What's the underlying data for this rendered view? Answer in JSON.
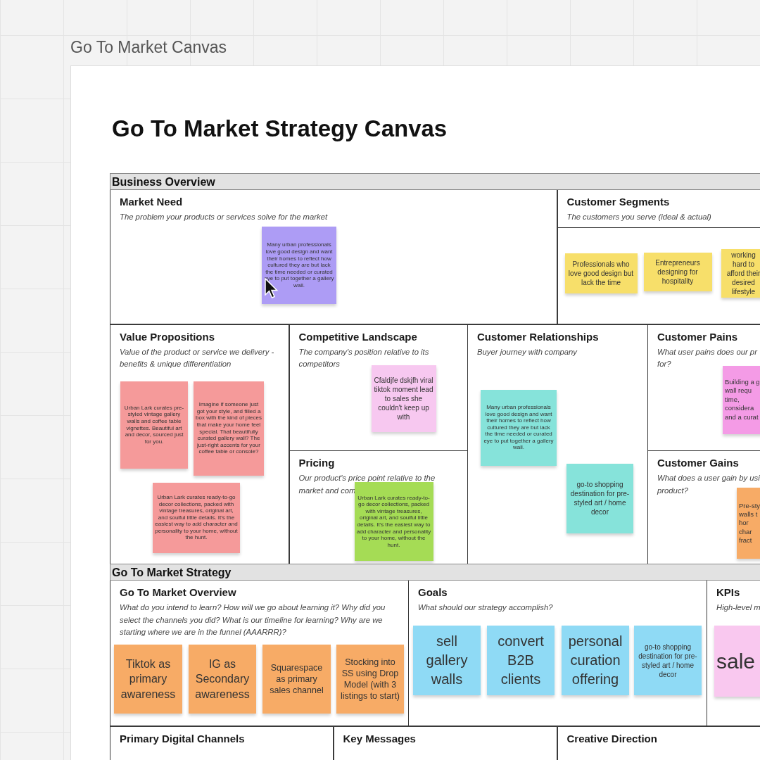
{
  "canvas": {
    "title": "Go To Market Canvas"
  },
  "board": {
    "title": "Go To Market Strategy Canvas",
    "groups": [
      {
        "heading": "Business Overview",
        "sections": [
          {
            "title": "Market Need",
            "subtitle": "The problem your products or services solve for the market",
            "notes": [
              {
                "text": "Many urban professionals love good design and want their homes to reflect how cultured they are but lack the time needed or curated eye to put together a gallery wall.",
                "color": "#ad9cf5",
                "kind": "tiny"
              }
            ]
          },
          {
            "title": "Customer Segments",
            "subtitle": "The customers you serve (ideal & actual)",
            "notes": [
              {
                "text": "Professionals who love good design but lack the time",
                "color": "#f7df6a",
                "kind": "small"
              },
              {
                "text": "Entrepreneurs designing for hospitality",
                "color": "#f7df6a",
                "kind": "small"
              },
              {
                "text": "working hard to afford their desired lifestyle",
                "color": "#f7df6a",
                "kind": "small"
              }
            ]
          },
          {
            "title": "Value Propositions",
            "subtitle": "Value of the product or service we delivery - benefits & unique differentiation",
            "notes": [
              {
                "text": "Urban Lark curates pre-styled vintage gallery walls and coffee table vignettes. Beautiful art and decor, sourced just for you.",
                "color": "#f59a9a",
                "kind": "tiny"
              },
              {
                "text": "Imagine if someone just got your style, and filled a box with the kind of pieces that make your home feel special. That beautifully curated gallery wall? The just-right accents for your coffee table or console?",
                "color": "#f59a9a",
                "kind": "tiny"
              },
              {
                "text": "Urban Lark curates ready-to-go decor collections, packed with vintage treasures, original art, and soulful little details. It's the easiest way to add character and personality to your home, without the hunt.",
                "color": "#f59a9a",
                "kind": "tiny"
              }
            ]
          },
          {
            "title": "Competitive Landscape",
            "subtitle": "The company's position relative to its competitors",
            "notes": [
              {
                "text": "Cfaldjfe dskjfh viral tiktok moment lead to sales she couldn't keep up with",
                "color": "#f7c8f0",
                "kind": "small"
              }
            ]
          },
          {
            "title": "Pricing",
            "subtitle": "Our product's price point relative to the market and com",
            "notes": [
              {
                "text": "Urban Lark curates ready-to-go decor collections, packed with vintage treasures, original art, and soulful little details. It's the easiest way to add character and personality to your home, without the hunt.",
                "color": "#a5dc55",
                "kind": "tiny"
              }
            ]
          },
          {
            "title": "Customer Relationships",
            "subtitle": "Buyer journey with company",
            "notes": [
              {
                "text": "Many urban professionals love good design and want their homes to reflect how cultured they are but lack the time needed or curated eye to put together a gallery wall.",
                "color": "#86e3da",
                "kind": "tiny"
              },
              {
                "text": "go-to shopping destination for pre-styled art / home decor",
                "color": "#86e3da",
                "kind": "small"
              }
            ]
          },
          {
            "title": "Customer Pains",
            "subtitle": "What user pains does our pr\nfor?",
            "notes": [
              {
                "text": "Building a g\nwall requ\ntime,\nconsidera\nand a curat",
                "color": "#f49be6",
                "kind": "small"
              }
            ]
          },
          {
            "title": "Customer Gains",
            "subtitle": "What does a user gain by usi\nproduct?",
            "notes": [
              {
                "text": "Pre-sty\nwalls t\nhor\nchar\nfract",
                "color": "#f7ab66",
                "kind": "small"
              }
            ]
          }
        ]
      },
      {
        "heading": "Go To Market Strategy",
        "sections": [
          {
            "title": "Go To Market Overview",
            "subtitle": "What do you intend to learn? How will we go about learning it? Why did you select the channels you did? What is our timeline for learning? Why are we starting where we are in the funnel (AAARRR)?",
            "notes": [
              {
                "text": "Tiktok as primary awareness",
                "color": "#f7ab66",
                "kind": "large"
              },
              {
                "text": "IG as Secondary awareness",
                "color": "#f7ab66",
                "kind": "large"
              },
              {
                "text": "Squarespace as primary sales channel",
                "color": "#f7ab66",
                "kind": "medium"
              },
              {
                "text": "Stocking into SS using Drop Model (with 3 listings to start)",
                "color": "#f7ab66",
                "kind": "medium"
              }
            ]
          },
          {
            "title": "Goals",
            "subtitle": "What should our strategy accomplish?",
            "notes": [
              {
                "text": "sell gallery walls",
                "color": "#8fdaf5",
                "kind": "xlarge"
              },
              {
                "text": "convert B2B clients",
                "color": "#8fdaf5",
                "kind": "xlarge"
              },
              {
                "text": "personal curation offering",
                "color": "#8fdaf5",
                "kind": "xlarge"
              },
              {
                "text": "go-to shopping destination for pre-styled art / home decor",
                "color": "#8fdaf5",
                "kind": "small"
              }
            ]
          },
          {
            "title": "KPIs",
            "subtitle": "High-level m",
            "notes": [
              {
                "text": "sale",
                "color": "#f9c8ef",
                "kind": "huge"
              }
            ]
          },
          {
            "title": "Primary Digital Channels"
          },
          {
            "title": "Key Messages"
          },
          {
            "title": "Creative Direction"
          }
        ]
      }
    ]
  }
}
